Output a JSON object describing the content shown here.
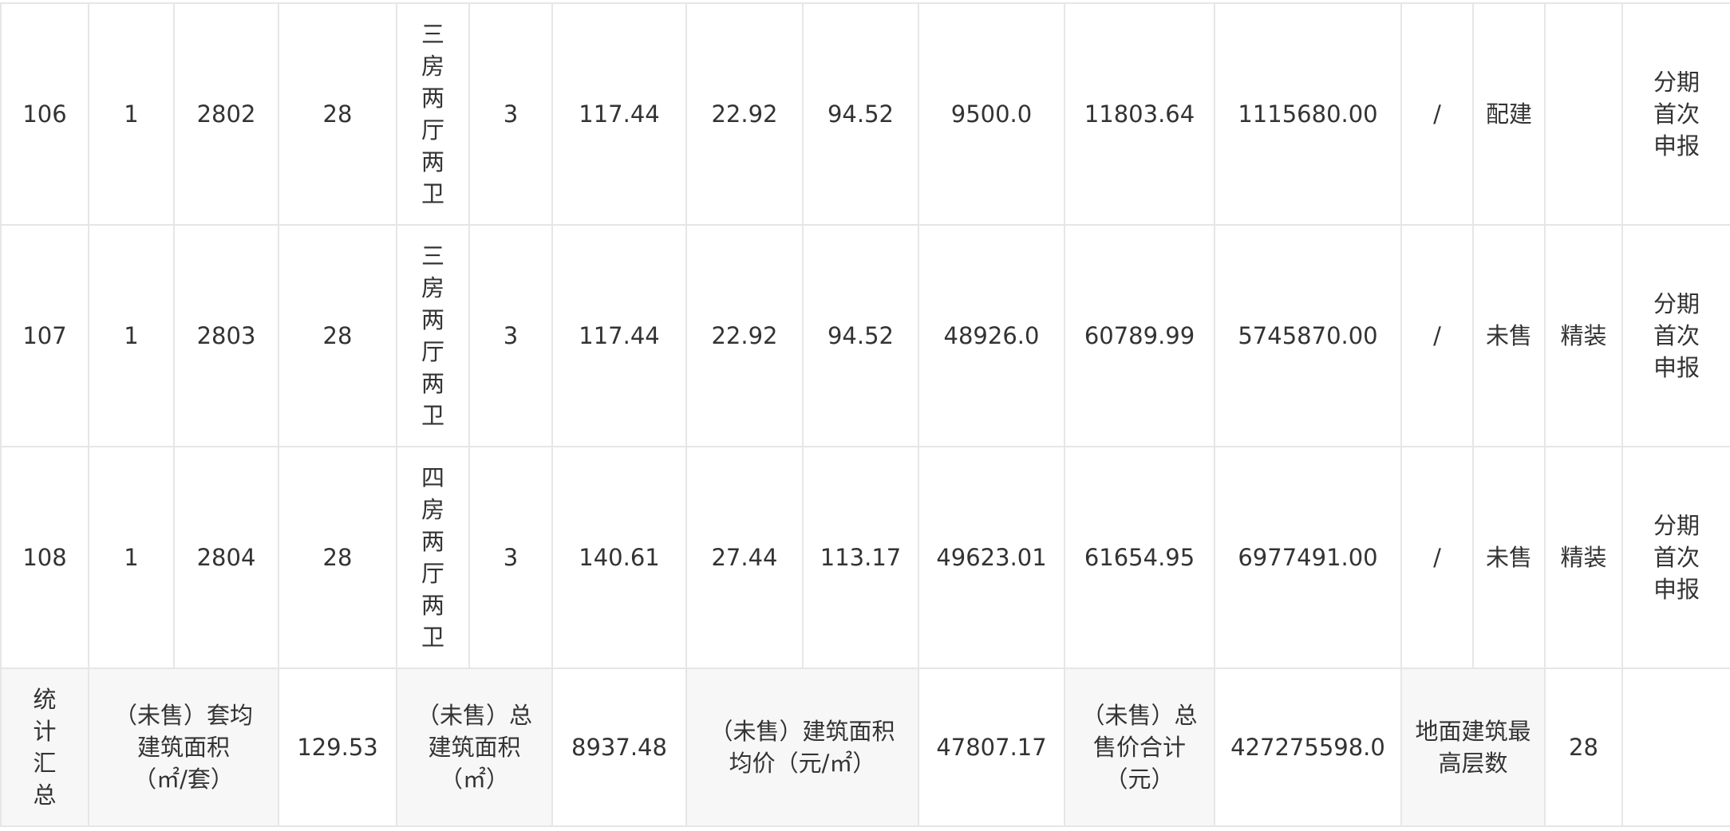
{
  "rows": [
    {
      "seq": "106",
      "unit": "1",
      "room": "2802",
      "floor": "28",
      "layout": "三房两厅两卫",
      "height": "3",
      "build_area": "117.44",
      "shared_area": "22.92",
      "inner_area": "94.52",
      "price_build": "9500.0",
      "price_inner": "11803.64",
      "total": "1115680.00",
      "slash": "/",
      "status": "配建",
      "decoration": "",
      "report": "分期首次申报"
    },
    {
      "seq": "107",
      "unit": "1",
      "room": "2803",
      "floor": "28",
      "layout": "三房两厅两卫",
      "height": "3",
      "build_area": "117.44",
      "shared_area": "22.92",
      "inner_area": "94.52",
      "price_build": "48926.0",
      "price_inner": "60789.99",
      "total": "5745870.00",
      "slash": "/",
      "status": "未售",
      "decoration": "精装",
      "report": "分期首次申报"
    },
    {
      "seq": "108",
      "unit": "1",
      "room": "2804",
      "floor": "28",
      "layout": "四房两厅两卫",
      "height": "3",
      "build_area": "140.61",
      "shared_area": "27.44",
      "inner_area": "113.17",
      "price_build": "49623.01",
      "price_inner": "61654.95",
      "total": "6977491.00",
      "slash": "/",
      "status": "未售",
      "decoration": "精装",
      "report": "分期首次申报"
    }
  ],
  "summary": {
    "label": "统计汇总",
    "avg_area_label": "（未售）套均建筑面积（㎡/套）",
    "avg_area_value": "129.53",
    "total_area_label": "（未售）总建筑面积（㎡）",
    "total_area_value": "8937.48",
    "avg_price_label": "（未售）建筑面积均价（元/㎡）",
    "avg_price_value": "47807.17",
    "total_price_label": "（未售）总售价合计（元）",
    "total_price_value": "427275598.0",
    "max_floor_label": "地面建筑最高层数",
    "max_floor_value": "28"
  }
}
